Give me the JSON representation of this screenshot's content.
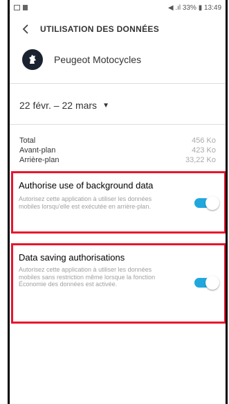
{
  "status_bar": {
    "right_text": "◀ .ıl 33% ▮ 13:49"
  },
  "header": {
    "title": "UTILISATION DES DONNÉES"
  },
  "app": {
    "name": "Peugeot Motocycles"
  },
  "date_range": {
    "label": "22 févr. – 22 mars"
  },
  "usage": [
    {
      "label": "Total",
      "value": "456 Ko"
    },
    {
      "label": "Avant-plan",
      "value": "423 Ko"
    },
    {
      "label": "Arrière-plan",
      "value": "33,22 Ko"
    }
  ],
  "settings": {
    "background_data": {
      "title": "Authorise use of background data",
      "description": "Autorisez cette application à utiliser les données mobiles lorsqu'elle est exécutée en arrière-plan.",
      "enabled": true
    },
    "data_saving": {
      "title": "Data saving authorisations",
      "description": "Autorisez cette application à utiliser les données mobiles sans restriction même lorsque la fonction Économie des données est activée.",
      "enabled": true
    }
  },
  "colors": {
    "accent": "#20a8de",
    "highlight_border": "#e8152d"
  }
}
